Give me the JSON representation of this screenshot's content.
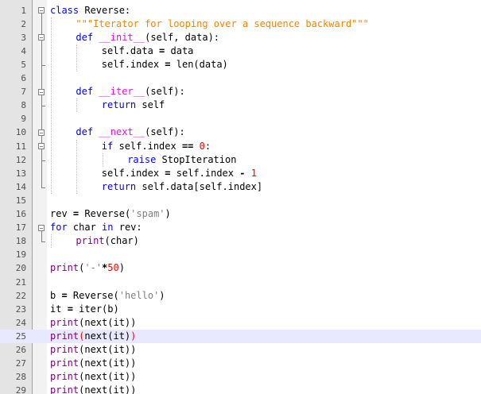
{
  "editor": {
    "current_line": 25,
    "lines": [
      {
        "n": "1",
        "indent": 0,
        "tokens": [
          {
            "t": "kw",
            "v": "class"
          },
          {
            "t": "plain",
            "v": " Reverse:"
          }
        ]
      },
      {
        "n": "2",
        "indent": 1,
        "tokens": [
          {
            "t": "doc",
            "v": "\"\"\"Iterator for looping over a sequence backward\"\"\""
          }
        ]
      },
      {
        "n": "3",
        "indent": 1,
        "tokens": [
          {
            "t": "kw",
            "v": "def"
          },
          {
            "t": "plain",
            "v": " "
          },
          {
            "t": "dunder",
            "v": "__init__"
          },
          {
            "t": "plain",
            "v": "(self, data):"
          }
        ]
      },
      {
        "n": "4",
        "indent": 2,
        "tokens": [
          {
            "t": "plain",
            "v": "self.data "
          },
          {
            "t": "op",
            "v": "="
          },
          {
            "t": "plain",
            "v": " data"
          }
        ]
      },
      {
        "n": "5",
        "indent": 2,
        "tokens": [
          {
            "t": "plain",
            "v": "self.index "
          },
          {
            "t": "op",
            "v": "="
          },
          {
            "t": "plain",
            "v": " len(data)"
          }
        ]
      },
      {
        "n": "6",
        "indent": 0,
        "tokens": []
      },
      {
        "n": "7",
        "indent": 1,
        "tokens": [
          {
            "t": "kw",
            "v": "def"
          },
          {
            "t": "plain",
            "v": " "
          },
          {
            "t": "dunder",
            "v": "__iter__"
          },
          {
            "t": "plain",
            "v": "(self):"
          }
        ]
      },
      {
        "n": "8",
        "indent": 2,
        "tokens": [
          {
            "t": "kw",
            "v": "return"
          },
          {
            "t": "plain",
            "v": " self"
          }
        ]
      },
      {
        "n": "9",
        "indent": 0,
        "tokens": []
      },
      {
        "n": "10",
        "indent": 1,
        "tokens": [
          {
            "t": "kw",
            "v": "def"
          },
          {
            "t": "plain",
            "v": " "
          },
          {
            "t": "dunder",
            "v": "__next__"
          },
          {
            "t": "plain",
            "v": "(self):"
          }
        ]
      },
      {
        "n": "11",
        "indent": 2,
        "tokens": [
          {
            "t": "kw",
            "v": "if"
          },
          {
            "t": "plain",
            "v": " self.index "
          },
          {
            "t": "op",
            "v": "=="
          },
          {
            "t": "plain",
            "v": " "
          },
          {
            "t": "num",
            "v": "0"
          },
          {
            "t": "plain",
            "v": ":"
          }
        ]
      },
      {
        "n": "12",
        "indent": 3,
        "tokens": [
          {
            "t": "kw",
            "v": "raise"
          },
          {
            "t": "plain",
            "v": " StopIteration"
          }
        ]
      },
      {
        "n": "13",
        "indent": 2,
        "tokens": [
          {
            "t": "plain",
            "v": "self.index "
          },
          {
            "t": "op",
            "v": "="
          },
          {
            "t": "plain",
            "v": " self.index "
          },
          {
            "t": "op",
            "v": "-"
          },
          {
            "t": "plain",
            "v": " "
          },
          {
            "t": "num",
            "v": "1"
          }
        ]
      },
      {
        "n": "14",
        "indent": 2,
        "tokens": [
          {
            "t": "kw",
            "v": "return"
          },
          {
            "t": "plain",
            "v": " self.data[self.index]"
          }
        ]
      },
      {
        "n": "15",
        "indent": 0,
        "tokens": []
      },
      {
        "n": "16",
        "indent": 0,
        "tokens": [
          {
            "t": "plain",
            "v": "rev "
          },
          {
            "t": "op",
            "v": "="
          },
          {
            "t": "plain",
            "v": " Reverse("
          },
          {
            "t": "str",
            "v": "'spam'"
          },
          {
            "t": "plain",
            "v": ")"
          }
        ]
      },
      {
        "n": "17",
        "indent": 0,
        "tokens": [
          {
            "t": "kw",
            "v": "for"
          },
          {
            "t": "plain",
            "v": " char "
          },
          {
            "t": "kw",
            "v": "in"
          },
          {
            "t": "plain",
            "v": " rev:"
          }
        ]
      },
      {
        "n": "18",
        "indent": 1,
        "tokens": [
          {
            "t": "bi",
            "v": "print"
          },
          {
            "t": "plain",
            "v": "(char)"
          }
        ]
      },
      {
        "n": "19",
        "indent": 0,
        "tokens": []
      },
      {
        "n": "20",
        "indent": 0,
        "tokens": [
          {
            "t": "bi",
            "v": "print"
          },
          {
            "t": "plain",
            "v": "("
          },
          {
            "t": "str",
            "v": "'-'"
          },
          {
            "t": "op",
            "v": "*"
          },
          {
            "t": "num",
            "v": "50"
          },
          {
            "t": "plain",
            "v": ")"
          }
        ]
      },
      {
        "n": "21",
        "indent": 0,
        "tokens": []
      },
      {
        "n": "22",
        "indent": 0,
        "tokens": [
          {
            "t": "plain",
            "v": "b "
          },
          {
            "t": "op",
            "v": "="
          },
          {
            "t": "plain",
            "v": " Reverse("
          },
          {
            "t": "str",
            "v": "'hello'"
          },
          {
            "t": "plain",
            "v": ")"
          }
        ]
      },
      {
        "n": "23",
        "indent": 0,
        "tokens": [
          {
            "t": "plain",
            "v": "it "
          },
          {
            "t": "op",
            "v": "="
          },
          {
            "t": "plain",
            "v": " iter(b)"
          }
        ]
      },
      {
        "n": "24",
        "indent": 0,
        "tokens": [
          {
            "t": "bi",
            "v": "print"
          },
          {
            "t": "plain",
            "v": "(next(it))"
          }
        ]
      },
      {
        "n": "25",
        "indent": 0,
        "tokens": [
          {
            "t": "bi",
            "v": "print"
          },
          {
            "t": "br",
            "v": "("
          },
          {
            "t": "plain",
            "v": "next(it)"
          },
          {
            "t": "br",
            "v": ")"
          }
        ]
      },
      {
        "n": "26",
        "indent": 0,
        "tokens": [
          {
            "t": "bi",
            "v": "print"
          },
          {
            "t": "plain",
            "v": "(next(it))"
          }
        ]
      },
      {
        "n": "27",
        "indent": 0,
        "tokens": [
          {
            "t": "bi",
            "v": "print"
          },
          {
            "t": "plain",
            "v": "(next(it))"
          }
        ]
      },
      {
        "n": "28",
        "indent": 0,
        "tokens": [
          {
            "t": "bi",
            "v": "print"
          },
          {
            "t": "plain",
            "v": "(next(it))"
          }
        ]
      },
      {
        "n": "29",
        "indent": 0,
        "tokens": [
          {
            "t": "bi",
            "v": "print"
          },
          {
            "t": "plain",
            "v": "(next(it))"
          }
        ]
      }
    ]
  },
  "colors": {
    "keyword": "#0000ff",
    "number": "#ff0000",
    "string": "#808080",
    "docstring": "#ff8000",
    "dunder": "#ff00ff",
    "builtin": "#800080",
    "current_line": "#e8e8ff",
    "gutter": "#e4e4e4"
  }
}
